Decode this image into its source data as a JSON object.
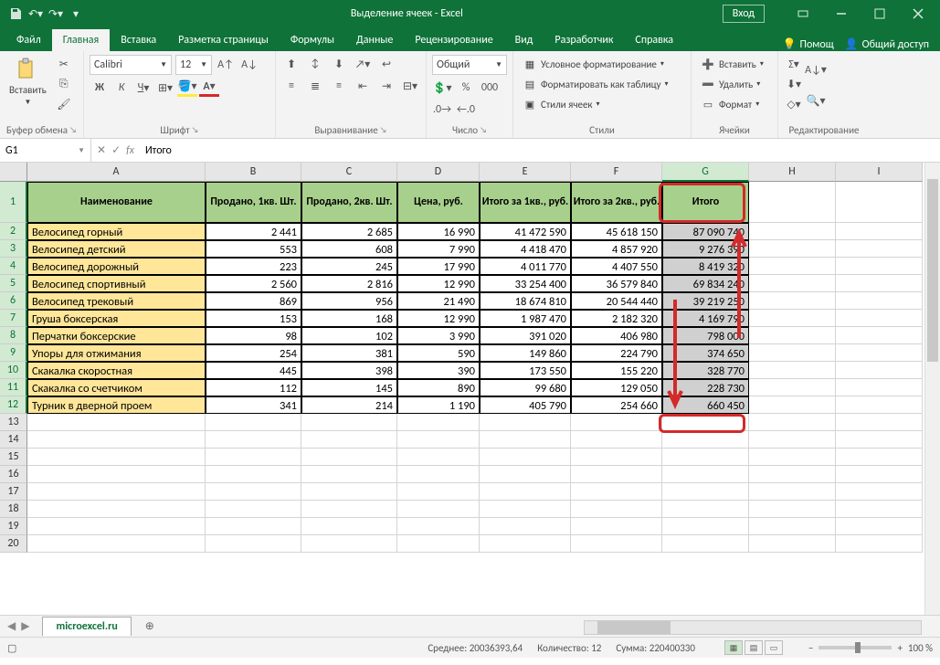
{
  "app": {
    "title": "Выделение ячеек  -  Excel",
    "signin": "Вход"
  },
  "qat": {
    "save": "save",
    "undo": "undo",
    "redo": "redo"
  },
  "tabs": [
    "Файл",
    "Главная",
    "Вставка",
    "Разметка страницы",
    "Формулы",
    "Данные",
    "Рецензирование",
    "Вид",
    "Разработчик",
    "Справка"
  ],
  "tell_me": "Помощ",
  "share": "Общий доступ",
  "ribbon": {
    "clipboard": {
      "paste": "Вставить",
      "label": "Буфер обмена"
    },
    "font": {
      "name": "Calibri",
      "size": "12",
      "label": "Шрифт"
    },
    "align": {
      "label": "Выравнивание"
    },
    "number": {
      "format": "Общий",
      "label": "Число"
    },
    "styles": {
      "cond": "Условное форматирование",
      "table": "Форматировать как таблицу",
      "cell": "Стили ячеек",
      "label": "Стили"
    },
    "cells": {
      "insert": "Вставить",
      "delete": "Удалить",
      "format": "Формат",
      "label": "Ячейки"
    },
    "editing": {
      "label": "Редактирование"
    }
  },
  "namebox": "G1",
  "formula": "Итого",
  "cols": [
    "A",
    "B",
    "C",
    "D",
    "E",
    "F",
    "G",
    "H",
    "I"
  ],
  "headers": [
    "Наименование",
    "Продано, 1кв. Шт.",
    "Продано, 2кв. Шт.",
    "Цена, руб.",
    "Итого за 1кв., руб.",
    "Итого за 2кв., руб.",
    "Итого"
  ],
  "rows": [
    {
      "n": "Велосипед горный",
      "d": [
        "2 441",
        "2 685",
        "16 990",
        "41 472 590",
        "45 618 150",
        "87 090 740"
      ]
    },
    {
      "n": "Велосипед детский",
      "d": [
        "553",
        "608",
        "7 990",
        "4 418 470",
        "4 857 920",
        "9 276 390"
      ]
    },
    {
      "n": "Велосипед дорожный",
      "d": [
        "223",
        "245",
        "17 990",
        "4 011 770",
        "4 407 550",
        "8 419 320"
      ]
    },
    {
      "n": "Велосипед спортивный",
      "d": [
        "2 560",
        "2 816",
        "12 990",
        "33 254 400",
        "36 579 840",
        "69 834 240"
      ]
    },
    {
      "n": "Велосипед трековый",
      "d": [
        "869",
        "956",
        "21 490",
        "18 674 810",
        "20 544 440",
        "39 219 250"
      ]
    },
    {
      "n": "Груша боксерская",
      "d": [
        "153",
        "168",
        "12 990",
        "1 987 470",
        "2 182 320",
        "4 169 790"
      ]
    },
    {
      "n": "Перчатки боксерские",
      "d": [
        "98",
        "102",
        "3 990",
        "391 020",
        "406 980",
        "798 000"
      ]
    },
    {
      "n": "Упоры для отжимания",
      "d": [
        "254",
        "381",
        "590",
        "149 860",
        "224 790",
        "374 650"
      ]
    },
    {
      "n": "Скакалка скоростная",
      "d": [
        "445",
        "398",
        "390",
        "173 550",
        "155 220",
        "328 770"
      ]
    },
    {
      "n": "Скакалка со счетчиком",
      "d": [
        "112",
        "145",
        "890",
        "99 680",
        "129 050",
        "228 730"
      ]
    },
    {
      "n": "Турник в дверной проем",
      "d": [
        "341",
        "214",
        "1 190",
        "405 790",
        "254 660",
        "660 450"
      ]
    }
  ],
  "sheet": "microexcel.ru",
  "status": {
    "avg_l": "Среднее:",
    "avg_v": "20036393,64",
    "cnt_l": "Количество:",
    "cnt_v": "12",
    "sum_l": "Сумма:",
    "sum_v": "220400330",
    "zoom": "100 %"
  },
  "empty_rows": [
    "13",
    "14",
    "15",
    "16",
    "17",
    "18",
    "19",
    "20"
  ]
}
